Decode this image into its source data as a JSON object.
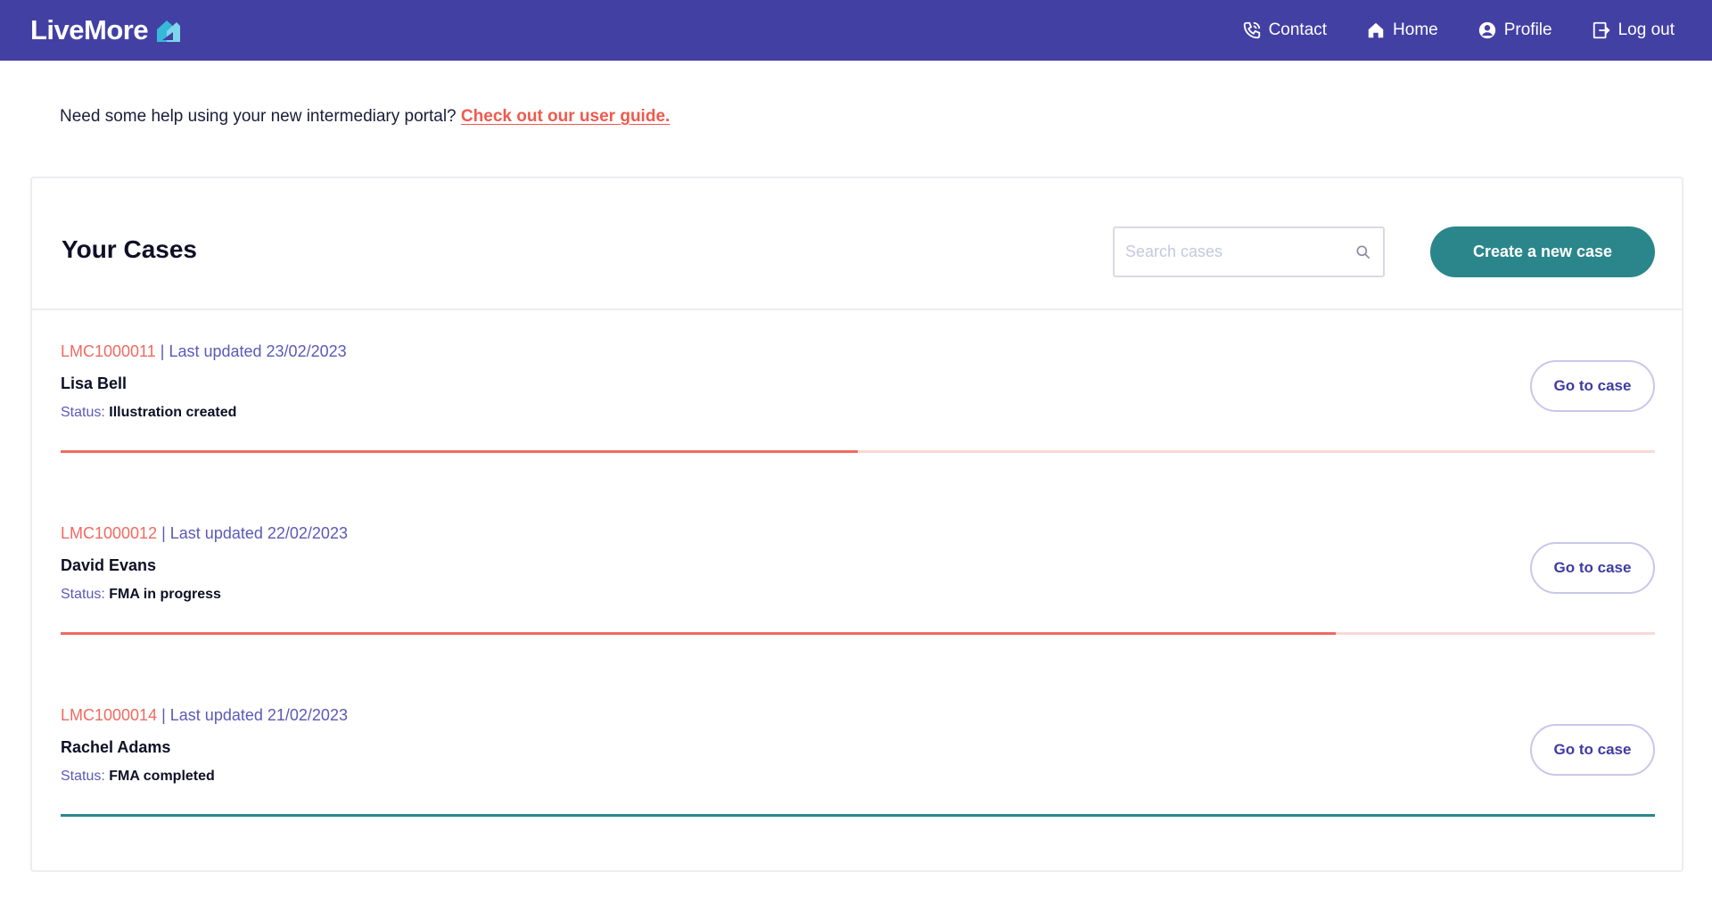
{
  "brand": {
    "name": "LiveMore",
    "logo_icon": "house-logo-icon"
  },
  "nav": [
    {
      "label": "Contact",
      "icon": "phone-icon"
    },
    {
      "label": "Home",
      "icon": "home-icon"
    },
    {
      "label": "Profile",
      "icon": "user-circle-icon"
    },
    {
      "label": "Log out",
      "icon": "logout-icon"
    }
  ],
  "help": {
    "text": "Need some help using your new intermediary portal?",
    "link": "Check out our user guide."
  },
  "cases_panel": {
    "title": "Your Cases",
    "search_placeholder": "Search cases",
    "create_label": "Create a new case"
  },
  "cases": [
    {
      "ref": "LMC1000011",
      "updated": "| Last updated 23/02/2023",
      "name": "Lisa Bell",
      "status_label": "Status:",
      "status": "Illustration created",
      "progress": 0.5,
      "complete": false,
      "button": "Go to case"
    },
    {
      "ref": "LMC1000012",
      "updated": "| Last updated 22/02/2023",
      "name": "David Evans",
      "status_label": "Status:",
      "status": "FMA in progress",
      "progress": 0.8,
      "complete": false,
      "button": "Go to case"
    },
    {
      "ref": "LMC1000014",
      "updated": "| Last updated 21/02/2023",
      "name": "Rachel Adams",
      "status_label": "Status:",
      "status": "FMA completed",
      "progress": 1.0,
      "complete": true,
      "button": "Go to case"
    }
  ],
  "colors": {
    "header": "#4340a4",
    "accent_red": "#ef6a60",
    "teal": "#2a868b",
    "link_purple": "#5b59b8"
  }
}
